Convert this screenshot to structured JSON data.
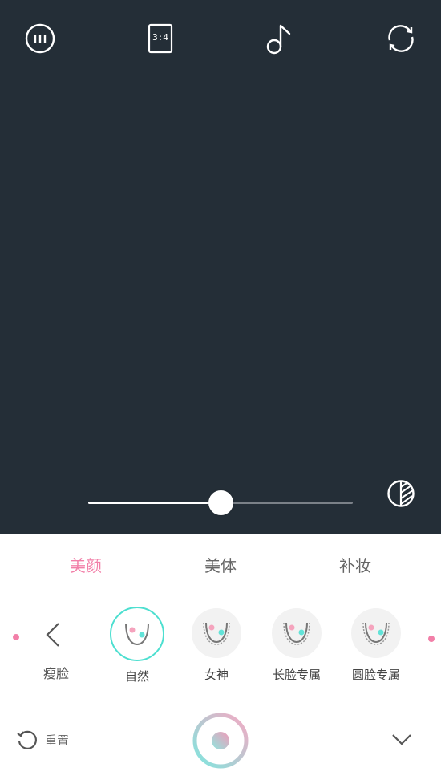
{
  "topbar": {
    "menu_icon": "menu-dots-icon",
    "ratio_label": "3:4",
    "music_icon": "music-note-icon",
    "switch_icon": "camera-switch-icon"
  },
  "slider": {
    "value_fraction": 0.5
  },
  "tabs": [
    {
      "label": "美颜",
      "active": true
    },
    {
      "label": "美体",
      "active": false
    },
    {
      "label": "补妆",
      "active": false
    }
  ],
  "back": {
    "label": "瘦脸"
  },
  "options": [
    {
      "label": "自然",
      "selected": true
    },
    {
      "label": "女神",
      "selected": false
    },
    {
      "label": "长脸专属",
      "selected": false
    },
    {
      "label": "圆脸专属",
      "selected": false
    }
  ],
  "bottom": {
    "reset_label": "重置"
  },
  "colors": {
    "accent_pink": "#f27fa8",
    "accent_teal": "#4ddfd0",
    "camera_bg": "#242e37"
  }
}
